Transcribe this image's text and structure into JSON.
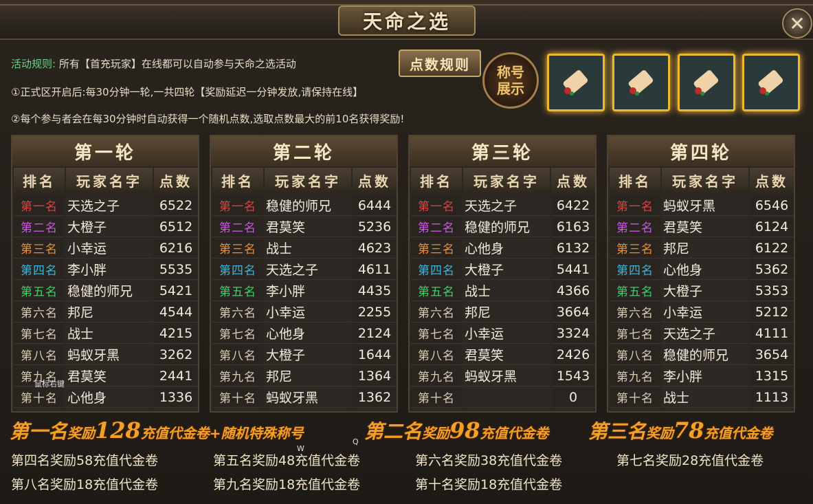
{
  "title": "天命之选",
  "close_symbol": "✕",
  "rules": {
    "label": "活动规则:",
    "line1": "所有【首充玩家】在线都可以自动参与天命之选活动",
    "line2": "①正式区开启后:每30分钟一轮,一共四轮【奖励延迟一分钟发放,请保持在线】",
    "line3": "②每个参与者会在每30分钟时自动获得一个随机点数,选取点数最大的前10名获得奖励!"
  },
  "points_rule_button": "点数规则",
  "title_show_button": "称号展示",
  "reward_slots": [
    "scroll-icon",
    "scroll-icon",
    "scroll-icon",
    "scroll-icon"
  ],
  "columns": {
    "rank": "排名",
    "name": "玩家名字",
    "points": "点数"
  },
  "rank_colors": [
    "#e0423c",
    "#c858e0",
    "#e7923a",
    "#3bb5d8",
    "#3fd06a",
    "#d8ccb4",
    "#d8ccb4",
    "#d8ccb4",
    "#d8ccb4",
    "#d8ccb4"
  ],
  "rounds": [
    {
      "title": "第一轮",
      "rows": [
        {
          "rank": "第一名",
          "name": "天选之子",
          "points": "6522"
        },
        {
          "rank": "第二名",
          "name": "大橙子",
          "points": "6512"
        },
        {
          "rank": "第三名",
          "name": "小幸运",
          "points": "6216"
        },
        {
          "rank": "第四名",
          "name": "李小胖",
          "points": "5535"
        },
        {
          "rank": "第五名",
          "name": "稳健的师兄",
          "points": "5421"
        },
        {
          "rank": "第六名",
          "name": "邦尼",
          "points": "4544"
        },
        {
          "rank": "第七名",
          "name": "战士",
          "points": "4215"
        },
        {
          "rank": "第八名",
          "name": "蚂蚁牙黑",
          "points": "3262"
        },
        {
          "rank": "第九名",
          "name": "君莫笑",
          "points": "2441"
        },
        {
          "rank": "第十名",
          "name": "心他身",
          "points": "1336"
        }
      ]
    },
    {
      "title": "第二轮",
      "rows": [
        {
          "rank": "第一名",
          "name": "稳健的师兄",
          "points": "6444"
        },
        {
          "rank": "第二名",
          "name": "君莫笑",
          "points": "5236"
        },
        {
          "rank": "第三名",
          "name": "战士",
          "points": "4623"
        },
        {
          "rank": "第四名",
          "name": "天选之子",
          "points": "4611"
        },
        {
          "rank": "第五名",
          "name": "李小胖",
          "points": "4435"
        },
        {
          "rank": "第六名",
          "name": "小幸运",
          "points": "2255"
        },
        {
          "rank": "第七名",
          "name": "心他身",
          "points": "2124"
        },
        {
          "rank": "第八名",
          "name": "大橙子",
          "points": "1644"
        },
        {
          "rank": "第九名",
          "name": "邦尼",
          "points": "1364"
        },
        {
          "rank": "第十名",
          "name": "蚂蚁牙黑",
          "points": "1362"
        }
      ]
    },
    {
      "title": "第三轮",
      "rows": [
        {
          "rank": "第一名",
          "name": "天选之子",
          "points": "6422"
        },
        {
          "rank": "第二名",
          "name": "稳健的师兄",
          "points": "6163"
        },
        {
          "rank": "第三名",
          "name": "心他身",
          "points": "6132"
        },
        {
          "rank": "第四名",
          "name": "大橙子",
          "points": "5441"
        },
        {
          "rank": "第五名",
          "name": "战士",
          "points": "4366"
        },
        {
          "rank": "第六名",
          "name": "邦尼",
          "points": "3664"
        },
        {
          "rank": "第七名",
          "name": "小幸运",
          "points": "3324"
        },
        {
          "rank": "第八名",
          "name": "君莫笑",
          "points": "2426"
        },
        {
          "rank": "第九名",
          "name": "蚂蚁牙黑",
          "points": "1543"
        },
        {
          "rank": "第十名",
          "name": "",
          "points": "0"
        }
      ]
    },
    {
      "title": "第四轮",
      "rows": [
        {
          "rank": "第一名",
          "name": "蚂蚁牙黑",
          "points": "6546"
        },
        {
          "rank": "第二名",
          "name": "君莫笑",
          "points": "6124"
        },
        {
          "rank": "第三名",
          "name": "邦尼",
          "points": "6122"
        },
        {
          "rank": "第四名",
          "name": "心他身",
          "points": "5362"
        },
        {
          "rank": "第五名",
          "name": "大橙子",
          "points": "5353"
        },
        {
          "rank": "第六名",
          "name": "小幸运",
          "points": "5212"
        },
        {
          "rank": "第七名",
          "name": "天选之子",
          "points": "4111"
        },
        {
          "rank": "第八名",
          "name": "稳健的师兄",
          "points": "3654"
        },
        {
          "rank": "第九名",
          "name": "李小胖",
          "points": "1315"
        },
        {
          "rank": "第十名",
          "name": "战士",
          "points": "1113"
        }
      ]
    }
  ],
  "rewards": {
    "first": {
      "rank": "第一名",
      "word": "奖励",
      "num": "128",
      "text": "充值代金卷+随机特殊称号"
    },
    "second": {
      "rank": "第二名",
      "word": "奖励",
      "num": "98",
      "text": "充值代金卷"
    },
    "third": {
      "rank": "第三名",
      "word": "奖励",
      "num": "78",
      "text": "充值代金卷"
    },
    "small": [
      "第四名奖励58充值代金卷",
      "第五名奖励48充值代金卷",
      "第六名奖励38充值代金卷",
      "第七名奖励28充值代金卷",
      "第八名奖励18充值代金卷",
      "第九名奖励18充值代金卷",
      "第十名奖励18充值代金卷"
    ]
  },
  "overlay": {
    "tooltip": "鼠标右键",
    "key_w": "W",
    "key_q": "Q"
  }
}
